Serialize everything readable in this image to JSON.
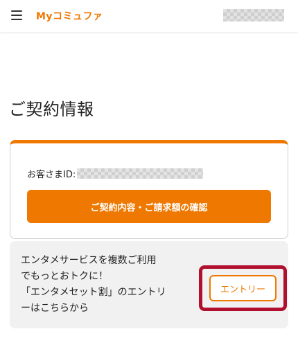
{
  "header": {
    "logo_text": "Myコミュファ",
    "brand_color": "#ee7800",
    "menu_icon": "hamburger-menu-icon"
  },
  "page": {
    "title": "ご契約情報"
  },
  "contract_card": {
    "customer_id_label": "お客さまID:",
    "confirm_button_label": "ご契約内容・ご請求額の確認",
    "accent_color": "#ee7800"
  },
  "banner": {
    "lines": [
      "エンタメサービスを複数ご利用",
      "でもっとおトクに！",
      "「エンタメセット割」のエントリ",
      "ーはこちらから"
    ],
    "entry_button_label": "エントリー",
    "highlight_color": "#b0102e"
  }
}
